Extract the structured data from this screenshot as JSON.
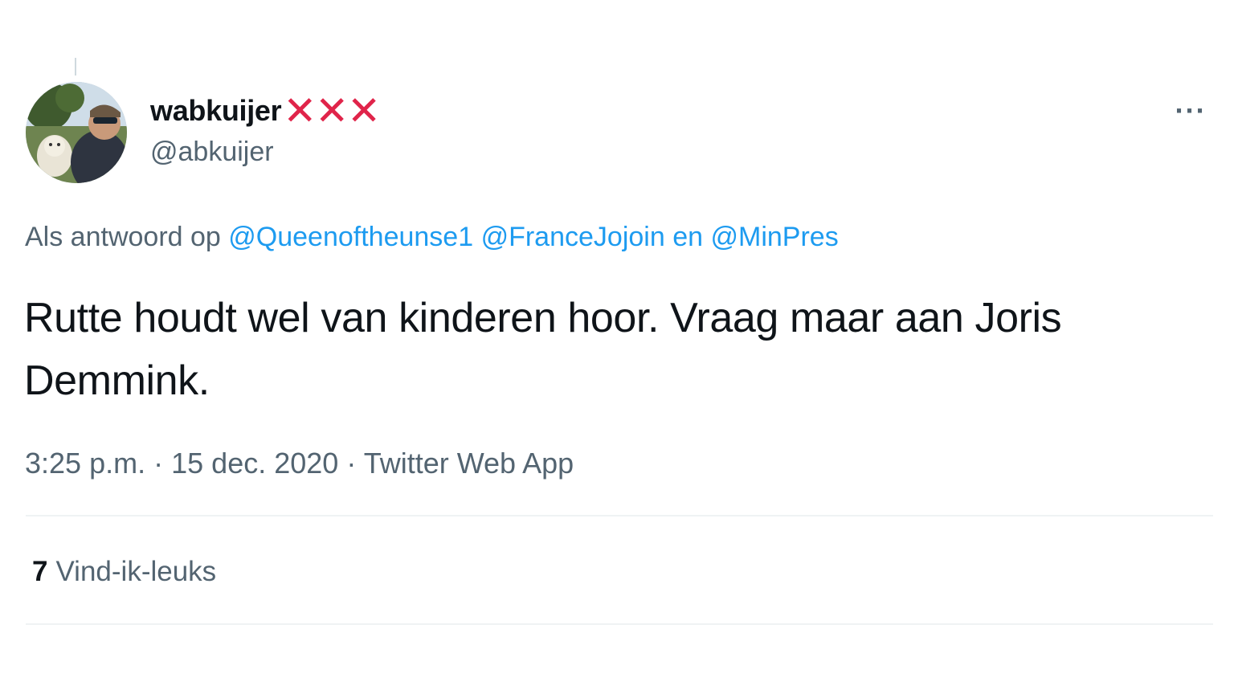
{
  "author": {
    "display_name": "wabkuijer",
    "name_suffix": "✕✕✕",
    "handle": "@abkuijer",
    "avatar_icon": "user-avatar-photo"
  },
  "more_icon": "···",
  "reply": {
    "prefix": "Als antwoord op",
    "mentions": [
      "@Queenoftheunse1",
      "@FranceJojoin",
      "@MinPres"
    ],
    "conjunction": "en"
  },
  "tweet_text": "Rutte houdt wel van kinderen hoor. Vraag maar aan Joris Demmink.",
  "meta": {
    "time": "3:25 p.m.",
    "date": "15 dec. 2020",
    "source": "Twitter Web App",
    "separator": "·"
  },
  "likes": {
    "count": "7",
    "label": "Vind-ik-leuks"
  },
  "colors": {
    "text": "#0f1419",
    "secondary": "#536471",
    "link": "#1d9bf0",
    "accent_x": "#e0244a",
    "divider": "#eff3f4"
  }
}
